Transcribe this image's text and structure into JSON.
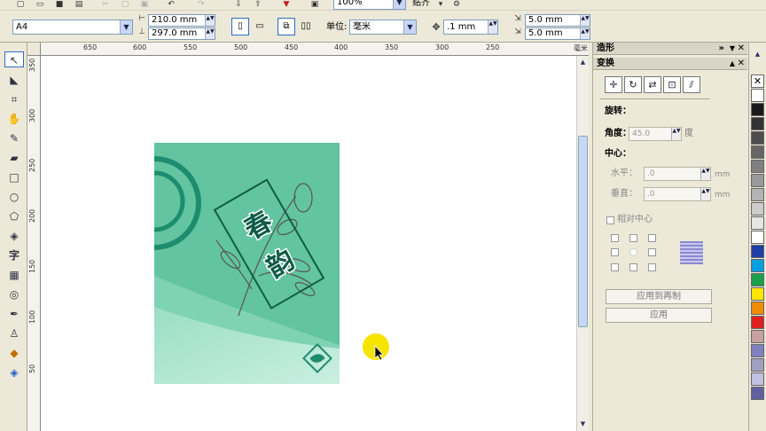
{
  "toolbar": {
    "zoom_value": "100%",
    "snap_label": "贴齐",
    "paper_preset": "A4",
    "width_value": "210.0 mm",
    "height_value": "297.0 mm",
    "units_label": "单位:",
    "units_value": "毫米",
    "nudge_value": ".1 mm",
    "dup_x_value": "5.0 mm",
    "dup_y_value": "5.0 mm"
  },
  "rulers": {
    "h_ticks": [
      "650",
      "600",
      "550",
      "500",
      "450",
      "400",
      "350",
      "300",
      "250",
      "毫米"
    ],
    "v_ticks": [
      "350",
      "300",
      "250",
      "200",
      "150",
      "100",
      "50"
    ]
  },
  "artwork": {
    "char1": "春",
    "char2": "韵",
    "page_color": "#62c4a0",
    "accent_color": "#1e8c6e"
  },
  "panel": {
    "outer_title": "造形",
    "title": "变换",
    "rotate_label": "旋转：",
    "angle_label": "角度：",
    "angle_value": "45.0",
    "angle_unit": "度",
    "center_label": "中心：",
    "h_label": "水平：",
    "h_value": ".0",
    "v_label": "垂直：",
    "v_value": ".0",
    "mm1": "mm",
    "mm2": "mm",
    "relative_center": "相对中心",
    "apply_dup": "应用到再制",
    "apply": "应用"
  },
  "palette_colors": [
    "#ffffff",
    "#1a1a1a",
    "#333333",
    "#4d4d4d",
    "#666666",
    "#808080",
    "#999999",
    "#b3b3b3",
    "#cccccc",
    "#e6e6e6",
    "#ffffff",
    "#1f3fa6",
    "#00a0e0",
    "#1aa04a",
    "#ffe600",
    "#f08c00",
    "#e02020",
    "#c8a0a0",
    "#8080c0",
    "#a0a0c0",
    "#c0c0e0",
    "#6060a0"
  ]
}
